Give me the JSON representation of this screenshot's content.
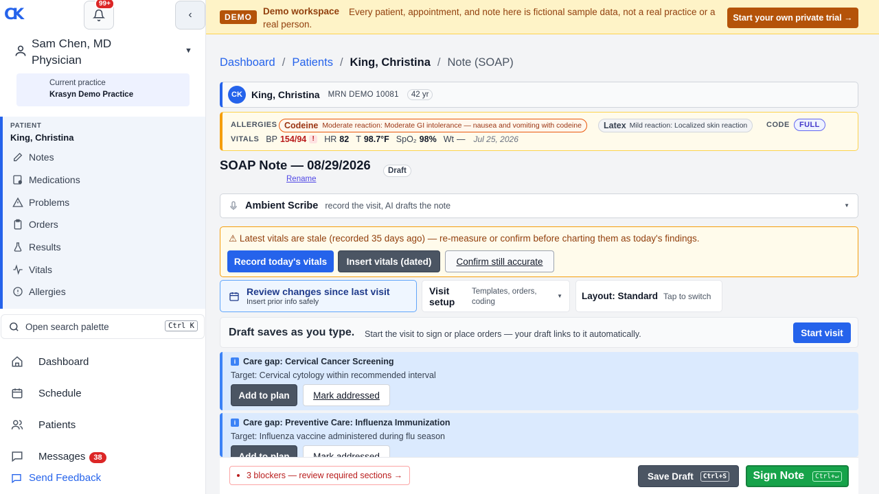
{
  "sidebar": {
    "logo_text": "CK",
    "notification_count": "99+",
    "collapse_glyph": "‹",
    "user": {
      "name": "Sam Chen, MD",
      "role": "Physician"
    },
    "practice": {
      "label": "Current practice",
      "name": "Krasyn Demo Practice"
    },
    "patient": {
      "label": "PATIENT",
      "name": "King, Christina",
      "items": [
        {
          "label": "Notes",
          "icon": "edit-icon"
        },
        {
          "label": "Medications",
          "icon": "pill-icon"
        },
        {
          "label": "Problems",
          "icon": "warning-icon"
        },
        {
          "label": "Orders",
          "icon": "clipboard-icon"
        },
        {
          "label": "Results",
          "icon": "flask-icon"
        },
        {
          "label": "Vitals",
          "icon": "pulse-icon"
        },
        {
          "label": "Allergies",
          "icon": "alert-circle-icon"
        }
      ]
    },
    "search": {
      "label": "Open search palette",
      "shortcut": "Ctrl K"
    },
    "nav": [
      {
        "label": "Dashboard",
        "icon": "home-icon"
      },
      {
        "label": "Schedule",
        "icon": "calendar-icon"
      },
      {
        "label": "Patients",
        "icon": "users-icon"
      },
      {
        "label": "Messages",
        "icon": "message-icon",
        "badge": "38"
      }
    ],
    "feedback": "Send Feedback"
  },
  "banner": {
    "tag": "DEMO",
    "title": "Demo workspace",
    "text": "Every patient, appointment, and note here is fictional sample data, not a real practice or a real person.",
    "cta": "Start your own private trial →"
  },
  "breadcrumb": {
    "items": [
      "Dashboard",
      "Patients"
    ],
    "current": "King, Christina",
    "last": "Note (SOAP)",
    "sep": "/"
  },
  "patient_header": {
    "initials": "CK",
    "name": "King, Christina",
    "mrn": "MRN  DEMO 10081",
    "age": "42 yr"
  },
  "allergies": {
    "label": "ALLERGIES",
    "items": [
      {
        "name": "Codeine",
        "severity": "Moderate",
        "reaction": "reaction: Moderate GI intolerance — nausea and vomiting with codeine"
      },
      {
        "name": "Latex",
        "severity": "Mild",
        "reaction": "reaction: Localized skin reaction"
      }
    ],
    "code_label": "CODE",
    "code_value": "FULL"
  },
  "vitals": {
    "label": "VITALS",
    "bp_label": "BP",
    "bp": "154/94",
    "bp_flag": "!",
    "hr_label": "HR",
    "hr": "82",
    "t_label": "T",
    "t": "98.7°F",
    "spo2_label": "SpO₂",
    "spo2": "98%",
    "wt_label": "Wt",
    "wt": "—",
    "date": "Jul 25, 2026"
  },
  "note": {
    "title": "SOAP Note — 08/29/2026",
    "status": "Draft",
    "rename": "Rename"
  },
  "scribe": {
    "title": "Ambient Scribe",
    "subtitle": "record the visit, AI drafts the note"
  },
  "stale": {
    "message": "⚠  Latest vitals are stale (recorded 35 days ago) — re-measure or confirm before charting them as today's findings.",
    "record": "Record today's vitals",
    "insert": "Insert vitals (dated)",
    "confirm": "Confirm still accurate"
  },
  "review": {
    "title": "Review changes since last visit",
    "subtitle": "Insert prior info safely"
  },
  "visit_setup": {
    "title": "Visit setup",
    "subtitle": "Templates, orders, coding"
  },
  "layout": {
    "title": "Layout: Standard",
    "subtitle": "Tap to switch"
  },
  "draft_banner": {
    "title": "Draft saves as you type.",
    "subtitle": "Start the visit to sign or place orders — your draft links to it automatically.",
    "start": "Start visit"
  },
  "care_gaps": [
    {
      "title": "Care gap: Cervical Cancer Screening",
      "target": "Target: Cervical cytology within recommended interval",
      "add": "Add to plan",
      "mark": "Mark addressed"
    },
    {
      "title": "Care gap: Preventive Care: Influenza Immunization",
      "target": "Target: Influenza vaccine administered during flu season",
      "add": "Add to plan",
      "mark": "Mark addressed"
    }
  ],
  "footer": {
    "blockers": "3 blockers — review required sections  →",
    "save": "Save Draft",
    "save_key": "Ctrl+S",
    "sign": "Sign Note",
    "sign_key": "Ctrl+↵"
  },
  "colors": {
    "accent": "#2563eb",
    "warning": "#b45309",
    "success": "#16a34a",
    "danger": "#dc2626"
  }
}
